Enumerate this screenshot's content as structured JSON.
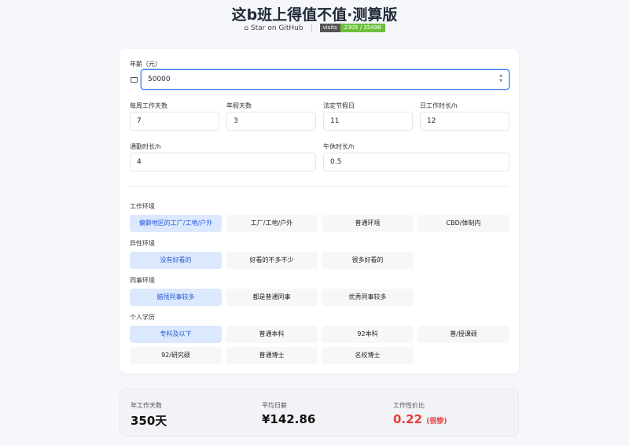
{
  "header": {
    "title": "这b班上得值不值·测算版",
    "github": "Star on GitHub",
    "visits_label": "visits",
    "visits_value": "2305 / 35498"
  },
  "salary": {
    "label": "年薪（元）",
    "value": "50000"
  },
  "fields": [
    {
      "label": "每周工作天数",
      "value": "7"
    },
    {
      "label": "年假天数",
      "value": "3"
    },
    {
      "label": "法定节假日",
      "value": "11"
    },
    {
      "label": "日工作时长/h",
      "value": "12"
    },
    {
      "label": "通勤时长/h",
      "value": "4"
    },
    {
      "label": "午休时长/h",
      "value": "0.5"
    }
  ],
  "groups": [
    {
      "label": "工作环境",
      "options": [
        "偏僻地区的工厂/工地/户外",
        "工厂/工地/户外",
        "普通环境",
        "CBD/体制内"
      ],
      "selected": 0
    },
    {
      "label": "异性环境",
      "options": [
        "没有好看的",
        "好看的不多不少",
        "很多好看的"
      ],
      "selected": 0
    },
    {
      "label": "同事环境",
      "options": [
        "脑残同事较多",
        "都是普通同事",
        "优秀同事较多"
      ],
      "selected": 0
    },
    {
      "label": "个人学历",
      "options": [
        "专科及以下",
        "普通本科",
        "92本科",
        "普/授课硕",
        "92/研究硕",
        "普通博士",
        "名校博士"
      ],
      "selected": 0
    }
  ],
  "results": {
    "days_label": "年工作天数",
    "days": "350天",
    "daily_label": "平均日薪",
    "daily": "¥142.86",
    "ratio_label": "工作性价比",
    "ratio": "0.22",
    "ratio_note": "(很惨)",
    "ratio_color": "#e53e3e"
  }
}
